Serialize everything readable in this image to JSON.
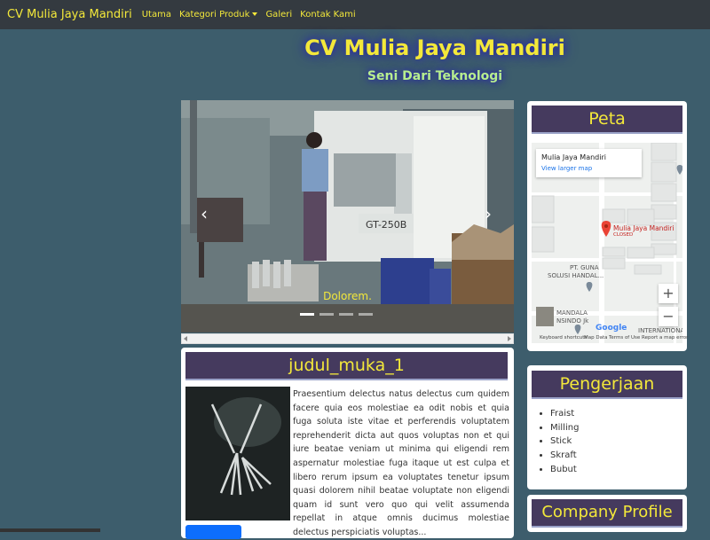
{
  "navbar": {
    "brand": "CV Mulia Jaya Mandiri",
    "links": [
      "Utama",
      "Kategori Produk",
      "Galeri",
      "Kontak Kami"
    ]
  },
  "hero": {
    "title": "CV Mulia Jaya Mandiri",
    "subtitle": "Seni Dari Teknologi"
  },
  "carousel": {
    "caption": "Dolorem.",
    "prev_icon": "chevron-left-icon",
    "next_icon": "chevron-right-icon",
    "machine_text": "GT-250B"
  },
  "article": {
    "title": "judul_muka_1",
    "body": "Praesentium delectus natus delectus cum quidem facere quia eos molestiae ea odit nobis et quia fuga soluta iste vitae et perferendis voluptatem reprehenderit dicta aut quos voluptas non et qui iure beatae veniam ut minima qui eligendi rem aspernatur molestiae fuga itaque ut est culpa et libero rerum ipsum ea voluptates tenetur ipsum quasi dolorem nihil beatae voluptate non eligendi quam id sunt vero quo qui velit assumenda repellat in atque omnis ducimus molestiae delectus perspiciatis voluptas..."
  },
  "map_card": {
    "title": "Peta",
    "place_name": "Mulia Jaya Mandiri",
    "link": "View larger map",
    "pin_label": "Mulia Jaya Mandiri",
    "pin_status": "CLOSED",
    "poi_1": "PT. GUNA",
    "poi_1b": "SOLUSI HANDAL...",
    "poi_2": "MANDALA",
    "poi_2b": "NSINDO Jk",
    "poi_3": "INTERNATIONA",
    "logo": "Google",
    "footer": [
      "Keyboard shortcuts",
      "Map Data",
      "Terms of Use",
      "Report a map error"
    ]
  },
  "pengerjaan": {
    "title": "Pengerjaan",
    "items": [
      "Fraist",
      "Milling",
      "Stick",
      "Skraft",
      "Bubut"
    ]
  },
  "company": {
    "title": "Company Profile"
  },
  "colors": {
    "page_bg": "#3d5d6c",
    "navbar_bg": "#343a40",
    "accent_yellow": "#f3e83a",
    "card_head": "#453a5e",
    "subtitle_green": "#b7ee8e"
  }
}
